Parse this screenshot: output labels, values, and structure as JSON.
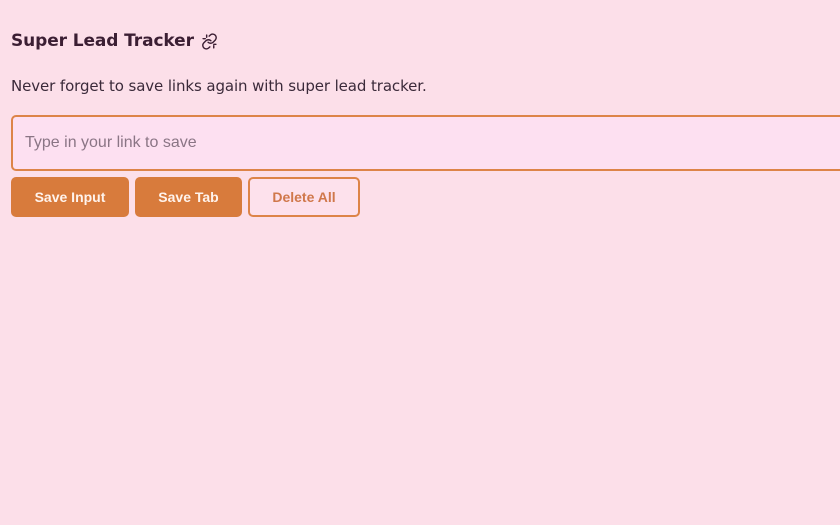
{
  "header": {
    "title": "Super Lead Tracker",
    "icon": "link-icon",
    "subtitle": "Never forget to save links again with super lead tracker."
  },
  "input": {
    "placeholder": "Type in your link to save",
    "value": ""
  },
  "buttons": {
    "save_input_label": "Save Input",
    "save_tab_label": "Save Tab",
    "delete_all_label": "Delete All"
  },
  "colors": {
    "background": "#fcdfe9",
    "accent": "#d87b3c",
    "text": "#3b1e33"
  }
}
